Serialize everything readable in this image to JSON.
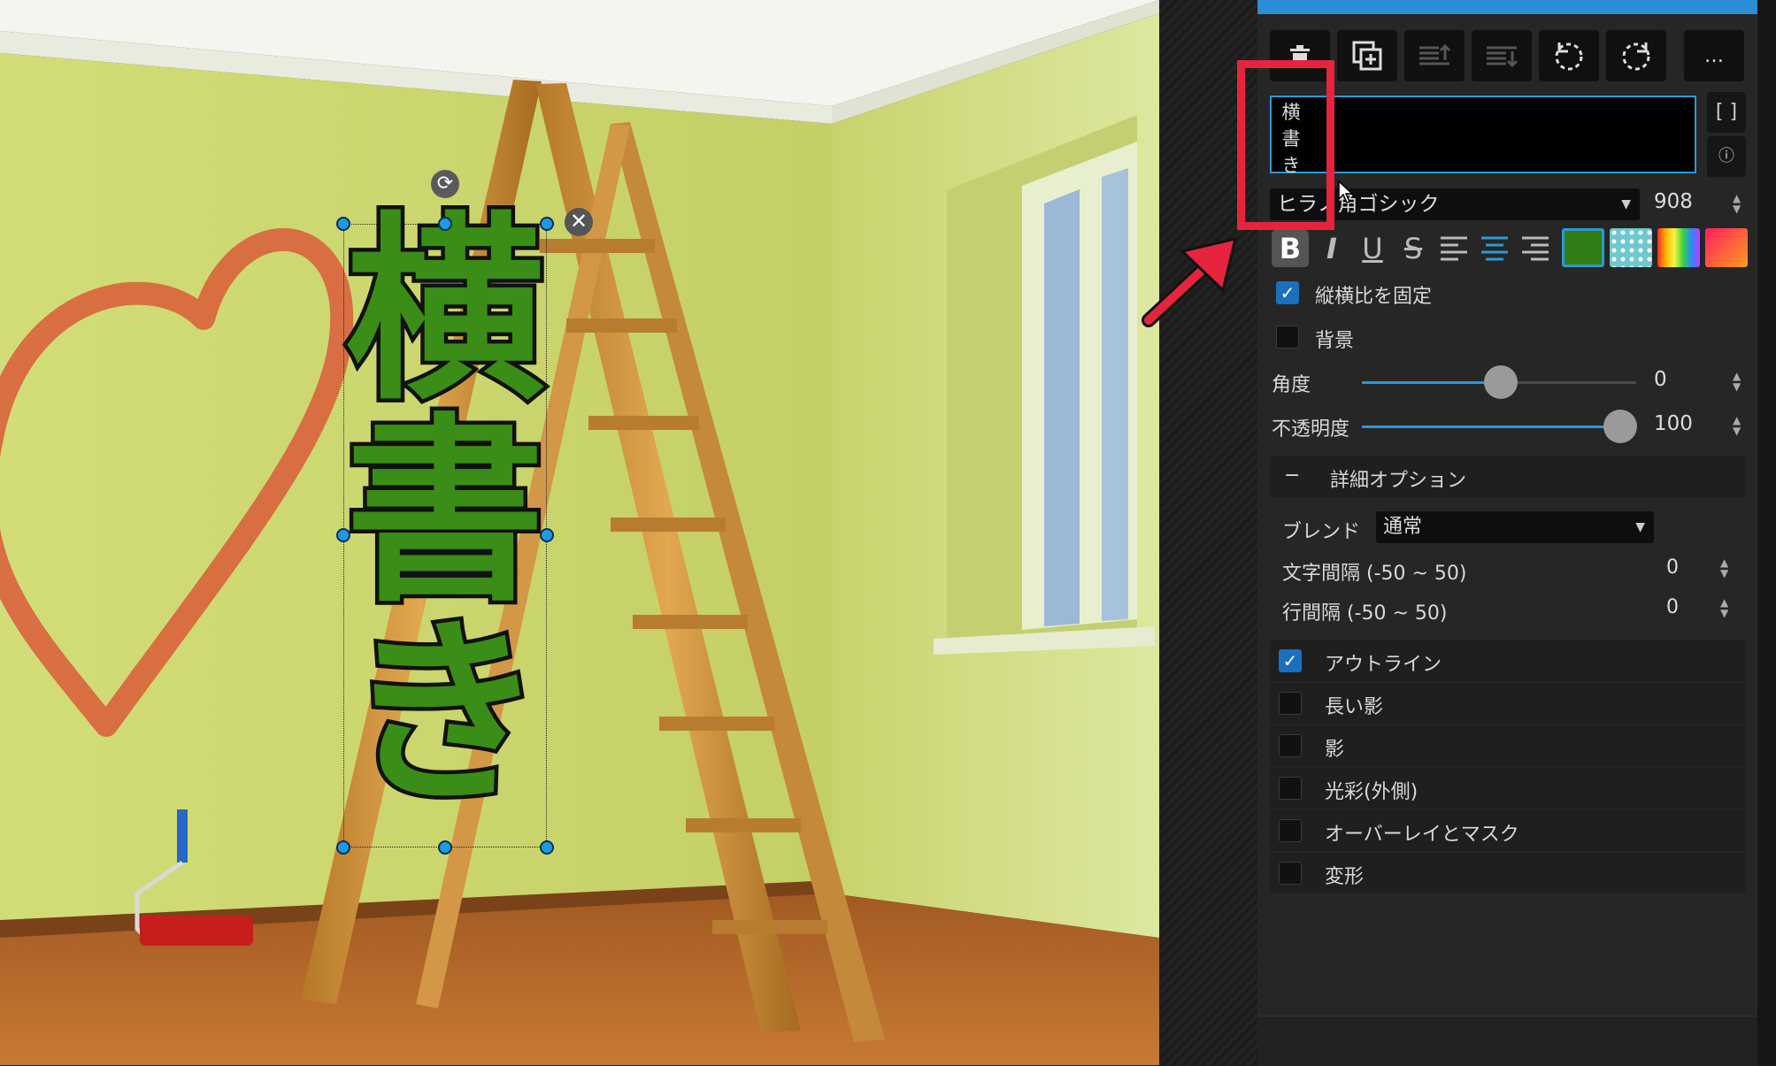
{
  "canvas": {
    "text_object": {
      "text": "横\n書\nき",
      "fill_color": "#3a8d16",
      "outline_color": "#111111"
    },
    "rotate_icon": "⟳",
    "delete_icon": "✕"
  },
  "toolbar": {
    "buttons": [
      "delete-layer",
      "duplicate",
      "bring-forward",
      "send-backward",
      "rotate-left",
      "rotate-right",
      "more"
    ],
    "more_label": "…"
  },
  "text_input": {
    "value": "横\n書\nき",
    "brackets_label": "[ ]",
    "info_icon": "ⓘ"
  },
  "font": {
    "family": "ヒラノ角ゴシック",
    "size": "908"
  },
  "format": {
    "bold": "B",
    "italic": "I",
    "underline": "U",
    "strike": "S",
    "fill_color": "#2f7d14",
    "swatches": [
      "texture",
      "gradient-rainbow",
      "gradient-pink"
    ]
  },
  "options": {
    "lock_ratio_label": "縦横比を固定",
    "lock_ratio_checked": true,
    "background_label": "背景",
    "background_checked": false
  },
  "angle": {
    "label": "角度",
    "value": "0",
    "level": 0.5
  },
  "opacity": {
    "label": "不透明度",
    "value": "100",
    "level": 1.0
  },
  "advanced": {
    "toggle": "−",
    "title": "詳細オプション",
    "blend_label": "ブレンド",
    "blend_value": "通常",
    "letter_spacing_label": "文字間隔 (-50 ~ 50)",
    "letter_spacing_value": "0",
    "line_spacing_label": "行間隔 (-50 ~ 50)",
    "line_spacing_value": "0"
  },
  "effects": [
    {
      "label": "アウトライン",
      "checked": true
    },
    {
      "label": "長い影",
      "checked": false
    },
    {
      "label": "影",
      "checked": false
    },
    {
      "label": "光彩(外側)",
      "checked": false
    },
    {
      "label": "オーバーレイとマスク",
      "checked": false
    },
    {
      "label": "変形",
      "checked": false
    }
  ],
  "colors": {
    "accent": "#2a8ed8",
    "annotation": "#e4253d",
    "panel_bg": "#262626"
  }
}
